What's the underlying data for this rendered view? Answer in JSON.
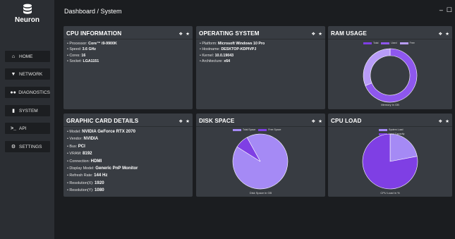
{
  "app": {
    "name": "Neuron"
  },
  "breadcrumb": "Dashboard / System",
  "window_controls": {
    "minimize": "–",
    "maximize": "☐"
  },
  "sidebar": {
    "items": [
      {
        "label": "HOME",
        "icon": "home-icon",
        "glyph": "🏠︎"
      },
      {
        "label": "NETWORK",
        "icon": "wifi-icon",
        "glyph": "📶︎"
      },
      {
        "label": "DIAGNOSTICS",
        "icon": "people-icon",
        "glyph": "👥︎"
      },
      {
        "label": "SYSTEM",
        "icon": "database-icon",
        "glyph": "⛁"
      },
      {
        "label": "API",
        "icon": "terminal-icon",
        "glyph": ">_"
      },
      {
        "label": "SETTINGS",
        "icon": "gear-icon",
        "glyph": "⚙"
      }
    ]
  },
  "cards": {
    "cpu_info": {
      "title": "CPU INFORMATION",
      "rows": [
        {
          "key": "Processor:",
          "value": "Core™ i9-9900K"
        },
        {
          "key": "Speed:",
          "value": "3.6 GHz"
        },
        {
          "key": "Cores:",
          "value": "16"
        },
        {
          "key": "Socket:",
          "value": "LGA1151"
        }
      ]
    },
    "os": {
      "title": "OPERATING SYSTEM",
      "rows": [
        {
          "key": "Platform:",
          "value": "Microsoft Windows 10 Pro"
        },
        {
          "key": "Hostname:",
          "value": "DESKTOP-KDPIVPJ"
        },
        {
          "key": "Kernel:",
          "value": "10.0.19043"
        },
        {
          "key": "Architecture:",
          "value": "x64"
        }
      ]
    },
    "ram": {
      "title": "RAM USAGE",
      "caption": "Memory in GB"
    },
    "gpu": {
      "title": "GRAPHIC CARD DETAILS",
      "rows": [
        {
          "key": "Model:",
          "value": "NVIDIA GeForce RTX 2070"
        },
        {
          "key": "Vendor:",
          "value": "NVIDIA"
        },
        {
          "key": "Bus:",
          "value": "PCI"
        },
        {
          "key": "VRAM:",
          "value": "8192"
        },
        {
          "key": "Connection:",
          "value": "HDMI"
        },
        {
          "key": "Display Model:",
          "value": "Generic PnP Monitor"
        },
        {
          "key": "Refresh Rate:",
          "value": "144 Hz"
        },
        {
          "key": "Resolution(X):",
          "value": "1920"
        },
        {
          "key": "Resolution(Y):",
          "value": "1080"
        }
      ]
    },
    "disk": {
      "title": "DISK SPACE",
      "caption": "Disk Space in GB"
    },
    "cpu_load": {
      "title": "CPU LOAD",
      "caption": "CPU Load in %"
    }
  },
  "card_icons": {
    "info": "info-icon",
    "star": "star-icon"
  },
  "colors": {
    "primary": "#7f3fe4",
    "secondary": "#9a6ff2",
    "tertiary": "#b89cf7",
    "card_bg": "#383c42",
    "sidebar_bg": "#2b2e33"
  },
  "chart_data": [
    {
      "type": "pie",
      "variant": "doughnut",
      "labels": [
        "Total",
        "Used",
        "Free"
      ],
      "values": [
        0,
        11,
        5
      ],
      "colors": [
        "#7f3fe4",
        "#8e57ee",
        "#b89cf7"
      ],
      "legend_position": "top"
    },
    {
      "type": "pie",
      "labels": [
        "Total Space",
        "Free Space"
      ],
      "values": [
        92,
        8
      ],
      "colors": [
        "#a58af5",
        "#7f3fe4"
      ],
      "legend_position": "top"
    },
    {
      "type": "pie",
      "labels": [
        "System Load",
        "Load Capacity"
      ],
      "values": [
        22,
        78
      ],
      "colors": [
        "#a58af5",
        "#7f3fe4"
      ],
      "legend_position": "top"
    }
  ]
}
